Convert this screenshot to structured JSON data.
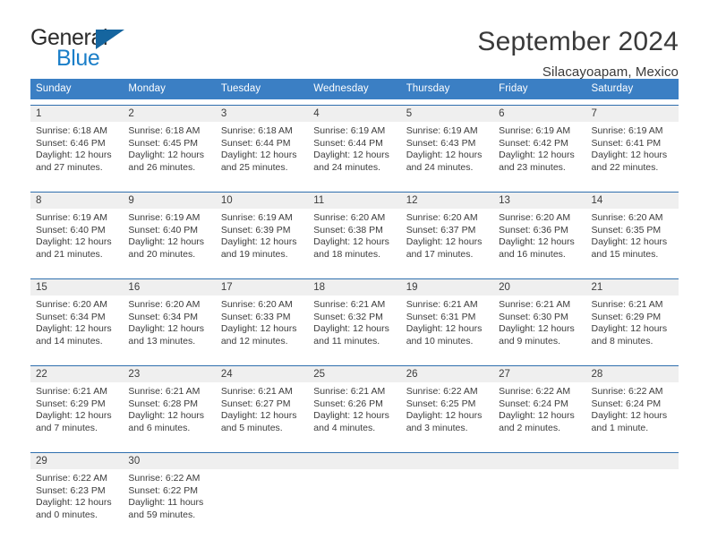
{
  "logo": {
    "text_top": "General",
    "text_bottom": "Blue",
    "icon": "triangle-icon",
    "color_blue": "#1a7ec8",
    "color_dark": "#2b2b2b"
  },
  "header": {
    "title": "September 2024",
    "subtitle": "Silacayoapam, Mexico"
  },
  "theme": {
    "header_row_bg": "#3b7fc4",
    "daynum_band_bg": "#efefef",
    "week_divider": "#2f6fae",
    "text": "#3c3c3c"
  },
  "weekdays": [
    "Sunday",
    "Monday",
    "Tuesday",
    "Wednesday",
    "Thursday",
    "Friday",
    "Saturday"
  ],
  "weeks": [
    {
      "days": [
        {
          "num": "1",
          "sunrise": "Sunrise: 6:18 AM",
          "sunset": "Sunset: 6:46 PM",
          "daylight1": "Daylight: 12 hours",
          "daylight2": "and 27 minutes."
        },
        {
          "num": "2",
          "sunrise": "Sunrise: 6:18 AM",
          "sunset": "Sunset: 6:45 PM",
          "daylight1": "Daylight: 12 hours",
          "daylight2": "and 26 minutes."
        },
        {
          "num": "3",
          "sunrise": "Sunrise: 6:18 AM",
          "sunset": "Sunset: 6:44 PM",
          "daylight1": "Daylight: 12 hours",
          "daylight2": "and 25 minutes."
        },
        {
          "num": "4",
          "sunrise": "Sunrise: 6:19 AM",
          "sunset": "Sunset: 6:44 PM",
          "daylight1": "Daylight: 12 hours",
          "daylight2": "and 24 minutes."
        },
        {
          "num": "5",
          "sunrise": "Sunrise: 6:19 AM",
          "sunset": "Sunset: 6:43 PM",
          "daylight1": "Daylight: 12 hours",
          "daylight2": "and 24 minutes."
        },
        {
          "num": "6",
          "sunrise": "Sunrise: 6:19 AM",
          "sunset": "Sunset: 6:42 PM",
          "daylight1": "Daylight: 12 hours",
          "daylight2": "and 23 minutes."
        },
        {
          "num": "7",
          "sunrise": "Sunrise: 6:19 AM",
          "sunset": "Sunset: 6:41 PM",
          "daylight1": "Daylight: 12 hours",
          "daylight2": "and 22 minutes."
        }
      ]
    },
    {
      "days": [
        {
          "num": "8",
          "sunrise": "Sunrise: 6:19 AM",
          "sunset": "Sunset: 6:40 PM",
          "daylight1": "Daylight: 12 hours",
          "daylight2": "and 21 minutes."
        },
        {
          "num": "9",
          "sunrise": "Sunrise: 6:19 AM",
          "sunset": "Sunset: 6:40 PM",
          "daylight1": "Daylight: 12 hours",
          "daylight2": "and 20 minutes."
        },
        {
          "num": "10",
          "sunrise": "Sunrise: 6:19 AM",
          "sunset": "Sunset: 6:39 PM",
          "daylight1": "Daylight: 12 hours",
          "daylight2": "and 19 minutes."
        },
        {
          "num": "11",
          "sunrise": "Sunrise: 6:20 AM",
          "sunset": "Sunset: 6:38 PM",
          "daylight1": "Daylight: 12 hours",
          "daylight2": "and 18 minutes."
        },
        {
          "num": "12",
          "sunrise": "Sunrise: 6:20 AM",
          "sunset": "Sunset: 6:37 PM",
          "daylight1": "Daylight: 12 hours",
          "daylight2": "and 17 minutes."
        },
        {
          "num": "13",
          "sunrise": "Sunrise: 6:20 AM",
          "sunset": "Sunset: 6:36 PM",
          "daylight1": "Daylight: 12 hours",
          "daylight2": "and 16 minutes."
        },
        {
          "num": "14",
          "sunrise": "Sunrise: 6:20 AM",
          "sunset": "Sunset: 6:35 PM",
          "daylight1": "Daylight: 12 hours",
          "daylight2": "and 15 minutes."
        }
      ]
    },
    {
      "days": [
        {
          "num": "15",
          "sunrise": "Sunrise: 6:20 AM",
          "sunset": "Sunset: 6:34 PM",
          "daylight1": "Daylight: 12 hours",
          "daylight2": "and 14 minutes."
        },
        {
          "num": "16",
          "sunrise": "Sunrise: 6:20 AM",
          "sunset": "Sunset: 6:34 PM",
          "daylight1": "Daylight: 12 hours",
          "daylight2": "and 13 minutes."
        },
        {
          "num": "17",
          "sunrise": "Sunrise: 6:20 AM",
          "sunset": "Sunset: 6:33 PM",
          "daylight1": "Daylight: 12 hours",
          "daylight2": "and 12 minutes."
        },
        {
          "num": "18",
          "sunrise": "Sunrise: 6:21 AM",
          "sunset": "Sunset: 6:32 PM",
          "daylight1": "Daylight: 12 hours",
          "daylight2": "and 11 minutes."
        },
        {
          "num": "19",
          "sunrise": "Sunrise: 6:21 AM",
          "sunset": "Sunset: 6:31 PM",
          "daylight1": "Daylight: 12 hours",
          "daylight2": "and 10 minutes."
        },
        {
          "num": "20",
          "sunrise": "Sunrise: 6:21 AM",
          "sunset": "Sunset: 6:30 PM",
          "daylight1": "Daylight: 12 hours",
          "daylight2": "and 9 minutes."
        },
        {
          "num": "21",
          "sunrise": "Sunrise: 6:21 AM",
          "sunset": "Sunset: 6:29 PM",
          "daylight1": "Daylight: 12 hours",
          "daylight2": "and 8 minutes."
        }
      ]
    },
    {
      "days": [
        {
          "num": "22",
          "sunrise": "Sunrise: 6:21 AM",
          "sunset": "Sunset: 6:29 PM",
          "daylight1": "Daylight: 12 hours",
          "daylight2": "and 7 minutes."
        },
        {
          "num": "23",
          "sunrise": "Sunrise: 6:21 AM",
          "sunset": "Sunset: 6:28 PM",
          "daylight1": "Daylight: 12 hours",
          "daylight2": "and 6 minutes."
        },
        {
          "num": "24",
          "sunrise": "Sunrise: 6:21 AM",
          "sunset": "Sunset: 6:27 PM",
          "daylight1": "Daylight: 12 hours",
          "daylight2": "and 5 minutes."
        },
        {
          "num": "25",
          "sunrise": "Sunrise: 6:21 AM",
          "sunset": "Sunset: 6:26 PM",
          "daylight1": "Daylight: 12 hours",
          "daylight2": "and 4 minutes."
        },
        {
          "num": "26",
          "sunrise": "Sunrise: 6:22 AM",
          "sunset": "Sunset: 6:25 PM",
          "daylight1": "Daylight: 12 hours",
          "daylight2": "and 3 minutes."
        },
        {
          "num": "27",
          "sunrise": "Sunrise: 6:22 AM",
          "sunset": "Sunset: 6:24 PM",
          "daylight1": "Daylight: 12 hours",
          "daylight2": "and 2 minutes."
        },
        {
          "num": "28",
          "sunrise": "Sunrise: 6:22 AM",
          "sunset": "Sunset: 6:24 PM",
          "daylight1": "Daylight: 12 hours",
          "daylight2": "and 1 minute."
        }
      ]
    },
    {
      "days": [
        {
          "num": "29",
          "sunrise": "Sunrise: 6:22 AM",
          "sunset": "Sunset: 6:23 PM",
          "daylight1": "Daylight: 12 hours",
          "daylight2": "and 0 minutes."
        },
        {
          "num": "30",
          "sunrise": "Sunrise: 6:22 AM",
          "sunset": "Sunset: 6:22 PM",
          "daylight1": "Daylight: 11 hours",
          "daylight2": "and 59 minutes."
        },
        {
          "num": "",
          "sunrise": "",
          "sunset": "",
          "daylight1": "",
          "daylight2": ""
        },
        {
          "num": "",
          "sunrise": "",
          "sunset": "",
          "daylight1": "",
          "daylight2": ""
        },
        {
          "num": "",
          "sunrise": "",
          "sunset": "",
          "daylight1": "",
          "daylight2": ""
        },
        {
          "num": "",
          "sunrise": "",
          "sunset": "",
          "daylight1": "",
          "daylight2": ""
        },
        {
          "num": "",
          "sunrise": "",
          "sunset": "",
          "daylight1": "",
          "daylight2": ""
        }
      ]
    }
  ]
}
